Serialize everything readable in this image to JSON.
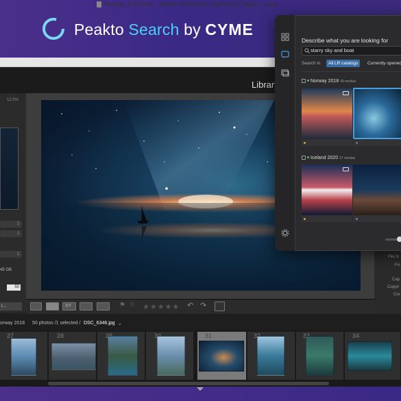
{
  "banner": {
    "prefix": "Peakto",
    "accent": "Search",
    "by": "by",
    "brand": "CYME",
    "colors": {
      "accent": "#4dd0f5",
      "background": "#4b2f8a"
    }
  },
  "window": {
    "title": "Norway 2018.lrcat - Adobe Photoshop Lightroom Classic - Libra"
  },
  "lightroom": {
    "module": "Library",
    "left_panel": {
      "zoom": "12.5%",
      "field_value": "50",
      "button_label": "t...",
      "labels": [
        "2",
        "1",
        "1"
      ],
      "size_text": "45 GB"
    },
    "toolbar": {
      "view_buttons": [
        "grid-view",
        "loupe-view",
        "compare-view",
        "survey-view",
        "people-view"
      ],
      "compare_label": "XY",
      "stars": "★★★★★"
    },
    "filmstrip": {
      "folder": "orway 2018",
      "status": "50 photos /1 selected /",
      "filename": "DSC_6346.jpg",
      "cells": [
        {
          "num": "27",
          "selected": false
        },
        {
          "num": "28",
          "selected": false
        },
        {
          "num": "29",
          "selected": false
        },
        {
          "num": "30",
          "selected": false
        },
        {
          "num": "31",
          "selected": true
        },
        {
          "num": "32",
          "selected": false
        },
        {
          "num": "33",
          "selected": false
        },
        {
          "num": "34",
          "selected": false
        }
      ]
    },
    "metadata_labels": [
      "File N",
      "Fo",
      "Cap",
      "Copyri",
      "Cre"
    ]
  },
  "peakto": {
    "sidebar_icons": [
      "grid-icon",
      "chat-search-icon",
      "media-icon",
      "settings-icon"
    ],
    "prompt_label": "Describe what you are looking for",
    "search_value": "starry sky and boat",
    "search_in_label": "Search in",
    "chips": {
      "active": "All LR catalogs",
      "inactive": "Currently opened"
    },
    "catalogs": [
      {
        "name": "Norway 2018",
        "count": "49 medias"
      },
      {
        "name": "Iceland 2020",
        "count": "37 medias"
      }
    ]
  }
}
